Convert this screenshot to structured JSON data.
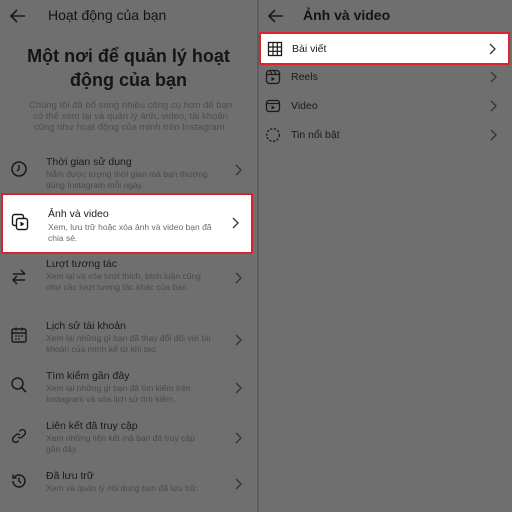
{
  "left": {
    "header": {
      "title": "Hoạt động của bạn"
    },
    "hero": {
      "title": "Một nơi để quản lý hoạt động của bạn",
      "description": "Chúng tôi đã bổ sung nhiều công cụ hơn để bạn có thể xem lại và quản lý ảnh, video, tài khoản cũng như hoạt động của mình trên Instagram."
    },
    "items": [
      {
        "title": "Thời gian sử dụng",
        "description": "Nắm được lượng thời gian mà bạn thường dùng Instagram mỗi ngày.",
        "icon": "clock-icon"
      },
      {
        "title": "Ảnh và video",
        "description": "Xem, lưu trữ hoặc xóa ảnh và video bạn đã chia sẻ.",
        "icon": "photo-video-icon"
      },
      {
        "title": "Lượt tương tác",
        "description": "Xem lại và xóa lượt thích, bình luận cũng như các lượt tương tác khác của bạn.",
        "icon": "arrows-exchange-icon"
      },
      {
        "title": "Lịch sử tài khoản",
        "description": "Xem lại những gì bạn đã thay đổi đối với tài khoản của mình kể từ khi tạo.",
        "icon": "calendar-icon"
      },
      {
        "title": "Tìm kiếm gần đây",
        "description": "Xem lại những gì bạn đã tìm kiếm trên Instagram và xóa lịch sử tìm kiếm.",
        "icon": "search-icon"
      },
      {
        "title": "Liên kết đã truy cập",
        "description": "Xem những liên kết mà bạn đã truy cập gần đây.",
        "icon": "link-icon"
      },
      {
        "title": "Đã lưu trữ",
        "description": "Xem và quản lý nội dung bạn đã lưu trữ.",
        "icon": "archive-history-icon"
      }
    ]
  },
  "right": {
    "header": {
      "title": "Ảnh và video"
    },
    "items": [
      {
        "title": "Bài viết",
        "icon": "grid-icon"
      },
      {
        "title": "Reels",
        "icon": "reels-icon"
      },
      {
        "title": "Video",
        "icon": "video-icon"
      },
      {
        "title": "Tin nổi bật",
        "icon": "highlights-icon"
      }
    ]
  },
  "colors": {
    "highlight_border": "#d9232d",
    "overlay": "#6f6f6f"
  }
}
